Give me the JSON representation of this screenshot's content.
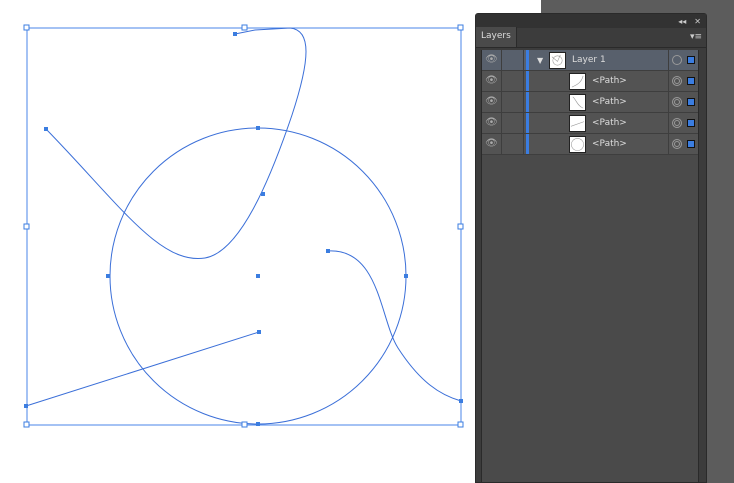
{
  "panel": {
    "title": "Layers",
    "collapse_icon": "◂◂",
    "close_icon": "✕",
    "menu_icon": "▾≡"
  },
  "layers": [
    {
      "name": "Layer 1",
      "selected": true,
      "expanded": true,
      "thumb": "layer"
    },
    {
      "name": "<Path>",
      "thumb": "curve1"
    },
    {
      "name": "<Path>",
      "thumb": "curve2"
    },
    {
      "name": "<Path>",
      "thumb": "line"
    },
    {
      "name": "<Path>",
      "thumb": "circle"
    }
  ],
  "colors": {
    "selection": "#3b7de0"
  }
}
